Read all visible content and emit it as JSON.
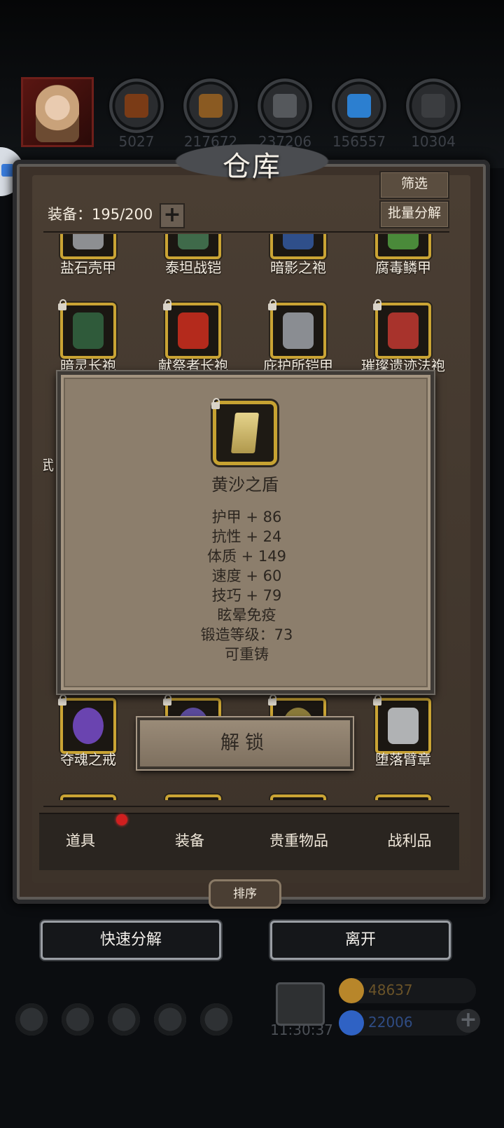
{
  "resources": [
    {
      "name": "wood-resource-icon",
      "count": "5027",
      "color": "#7a3b16"
    },
    {
      "name": "plank-resource-icon",
      "count": "217672",
      "color": "#8a5a22"
    },
    {
      "name": "iron-resource-icon",
      "count": "237206",
      "color": "#55585c"
    },
    {
      "name": "crystal-resource-icon",
      "count": "156557",
      "color": "#2c7fd0"
    },
    {
      "name": "ore-resource-icon",
      "count": "10304",
      "color": "#3b3d40"
    }
  ],
  "warehouse": {
    "title": "仓库",
    "filter_label": "筛选",
    "batch_label": "批量分解",
    "capacity_label": "装备：195/200",
    "add_label": "+"
  },
  "items": [
    {
      "label": "盐石壳甲",
      "locked": false,
      "color": "#8d8f92"
    },
    {
      "label": "泰坦战铠",
      "locked": false,
      "color": "#3f6a4a"
    },
    {
      "label": "暗影之袍",
      "locked": false,
      "color": "#2f4f8a"
    },
    {
      "label": "腐毒鳞甲",
      "locked": false,
      "color": "#4a8a3a"
    },
    {
      "label": "暗灵长袍",
      "locked": true,
      "color": "#2f5a3a"
    },
    {
      "label": "献祭者长袍",
      "locked": true,
      "color": "#b42a1c"
    },
    {
      "label": "庇护所铠甲",
      "locked": true,
      "color": "#8a8d92"
    },
    {
      "label": "璀璨遗迹法袍",
      "locked": true,
      "color": "#a8332c"
    },
    {
      "label": "夺魂之戒",
      "locked": true,
      "color": "#6a44b0"
    },
    {
      "label": "",
      "locked": true,
      "color": "#5a4a9a"
    },
    {
      "label": "",
      "locked": true,
      "color": "#8a7a3a"
    },
    {
      "label": "堕落臂章",
      "locked": true,
      "color": "#b0b2b4"
    }
  ],
  "partial_left_label": "武",
  "popup": {
    "item_name": "黄沙之盾",
    "icon": "sand-shield-icon",
    "stats": [
      "护甲 + 86",
      "抗性 + 24",
      "体质 + 149",
      "速度 + 60",
      "技巧 + 79",
      "眩晕免疫",
      "锻造等级：73",
      "可重铸"
    ],
    "unlock_label": "解锁"
  },
  "tabs": [
    {
      "label": "道具",
      "has_notification": true
    },
    {
      "label": "装备",
      "active": true
    },
    {
      "label": "贵重物品"
    },
    {
      "label": "战利品"
    }
  ],
  "sort_label": "排序",
  "quick_decompose_label": "快速分解",
  "leave_label": "离开",
  "hud": {
    "time": "11:30:37",
    "gold": "48637",
    "gems": "22006",
    "plus_label": "+",
    "colors": {
      "gold": "#b8862a",
      "gems": "#2f62c4"
    }
  }
}
